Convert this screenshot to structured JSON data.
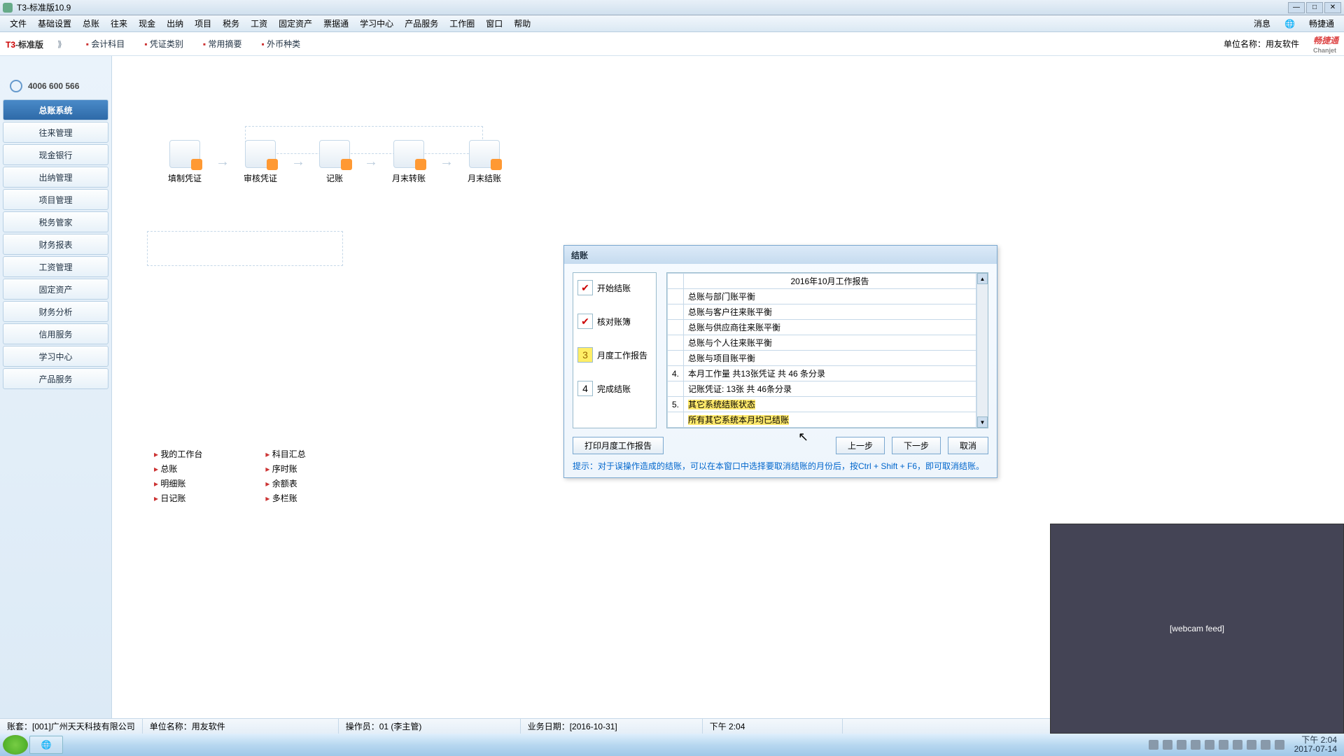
{
  "window": {
    "title": "T3-标准版10.9"
  },
  "menubar": [
    "文件",
    "基础设置",
    "总账",
    "往来",
    "现金",
    "出纳",
    "项目",
    "税务",
    "工资",
    "固定资产",
    "票据通",
    "学习中心",
    "产品服务",
    "工作圈",
    "窗口",
    "帮助"
  ],
  "menubar_right": {
    "msg": "消息",
    "cjt": "畅捷通"
  },
  "subbar": {
    "logo_a": "T3",
    "logo_b": "-标准版",
    "links": [
      "会计科目",
      "凭证类别",
      "常用摘要",
      "外币种类"
    ],
    "unit_label": "单位名称：",
    "unit_value": "用友软件",
    "brand": "畅捷通",
    "brand_en": "Chanjet"
  },
  "phone": "4006 600 566",
  "sidebar": [
    {
      "label": "总账系统",
      "active": true
    },
    {
      "label": "往来管理"
    },
    {
      "label": "现金银行"
    },
    {
      "label": "出纳管理"
    },
    {
      "label": "项目管理"
    },
    {
      "label": "税务管家"
    },
    {
      "label": "财务报表"
    },
    {
      "label": "工资管理"
    },
    {
      "label": "固定资产"
    },
    {
      "label": "财务分析"
    },
    {
      "label": "信用服务"
    },
    {
      "label": "学习中心"
    },
    {
      "label": "产品服务"
    }
  ],
  "flow": [
    "填制凭证",
    "审核凭证",
    "记账",
    "月末转账",
    "月末结账"
  ],
  "sublinks": {
    "col1": [
      "我的工作台",
      "总账",
      "明细账",
      "日记账"
    ],
    "col2": [
      "科目汇总",
      "序时账",
      "余额表",
      "多栏账"
    ]
  },
  "dialog": {
    "title": "结账",
    "steps": [
      {
        "label": "开始结账",
        "state": "done",
        "mark": "✔"
      },
      {
        "label": "核对账簿",
        "state": "done",
        "mark": "✔"
      },
      {
        "label": "月度工作报告",
        "state": "cur",
        "mark": "3"
      },
      {
        "label": "完成结账",
        "state": "",
        "mark": "4"
      }
    ],
    "report_title": "2016年10月工作报告",
    "rows": [
      {
        "n": "",
        "t": "总账与部门账平衡"
      },
      {
        "n": "",
        "t": "总账与客户往来账平衡"
      },
      {
        "n": "",
        "t": "总账与供应商往来账平衡"
      },
      {
        "n": "",
        "t": "总账与个人往来账平衡"
      },
      {
        "n": "",
        "t": "总账与项目账平衡"
      },
      {
        "n": "4.",
        "t": "本月工作量 共13张凭证 共 46 条分录"
      },
      {
        "n": "",
        "t": "记账凭证: 13张  共  46条分录"
      },
      {
        "n": "5.",
        "t": "其它系统结账状态"
      },
      {
        "n": "",
        "t": "所有其它系统本月均已结账"
      }
    ],
    "buttons": {
      "print": "打印月度工作报告",
      "prev": "上一步",
      "next": "下一步",
      "cancel": "取消"
    },
    "hint": "提示：对于误操作造成的结账，可以在本窗口中选择要取消结账的月份后，按Ctrl + Shift + F6，即可取消结账。"
  },
  "statusbar": {
    "acct": "账套：[001]广州天天科技有限公司",
    "unit": "单位名称：用友软件",
    "oper": "操作员：01 (李主管)",
    "date": "业务日期：[2016-10-31]",
    "time": "下午 2:04"
  },
  "taskbar": {
    "time": "下午 2:04",
    "date": "2017-07-14"
  },
  "webcam": "[webcam feed]"
}
